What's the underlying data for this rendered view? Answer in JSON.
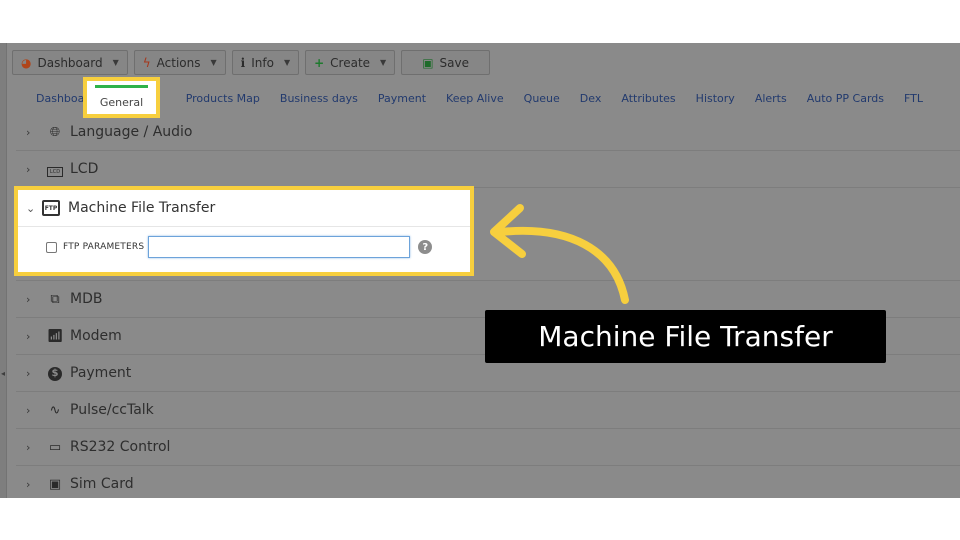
{
  "toolbar": {
    "dashboard": "Dashboard",
    "actions": "Actions",
    "info": "Info",
    "create": "Create",
    "save": "Save"
  },
  "tabs": [
    {
      "label": "Dashboard",
      "active": false
    },
    {
      "label": "General",
      "active": true
    },
    {
      "label": "Products Map",
      "active": false
    },
    {
      "label": "Business days",
      "active": false
    },
    {
      "label": "Payment",
      "active": false
    },
    {
      "label": "Keep Alive",
      "active": false
    },
    {
      "label": "Queue",
      "active": false
    },
    {
      "label": "Dex",
      "active": false
    },
    {
      "label": "Attributes",
      "active": false
    },
    {
      "label": "History",
      "active": false
    },
    {
      "label": "Alerts",
      "active": false
    },
    {
      "label": "Auto PP Cards",
      "active": false
    },
    {
      "label": "FTL",
      "active": false
    }
  ],
  "sections": [
    {
      "label": "Language / Audio",
      "icon": "globe-icon"
    },
    {
      "label": "LCD",
      "icon": "lcd-icon"
    },
    {
      "label": "Machine File Transfer",
      "icon": "ftp-icon",
      "expanded": true
    },
    {
      "label": "MDB",
      "icon": "network-icon"
    },
    {
      "label": "Modem",
      "icon": "modem-icon"
    },
    {
      "label": "Payment",
      "icon": "dollar-icon"
    },
    {
      "label": "Pulse/ccTalk",
      "icon": "pulse-icon"
    },
    {
      "label": "RS232 Control",
      "icon": "cable-icon"
    },
    {
      "label": "Sim Card",
      "icon": "sim-card-icon"
    }
  ],
  "ftp": {
    "checkbox_label": "FTP PARAMETERS",
    "input_value": "",
    "help": "?",
    "icon_text": "FTP"
  },
  "callout": {
    "text": "Machine File Transfer"
  },
  "colors": {
    "highlight": "#f7cf3e",
    "tab_active_bar": "#2fb34a",
    "callout_bg": "#000000",
    "overlay": "#8a8a8a"
  }
}
